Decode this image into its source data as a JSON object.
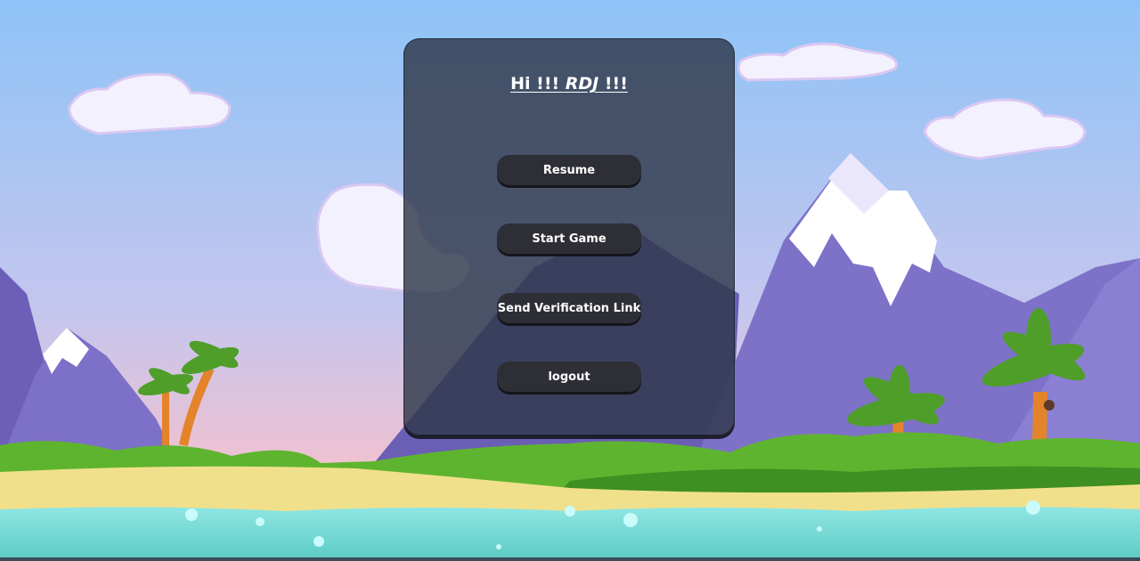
{
  "menu": {
    "greeting_prefix": "Hi !!! ",
    "player_name": "RDJ",
    "greeting_suffix": " !!!",
    "buttons": {
      "resume": "Resume",
      "start_game": "Start Game",
      "send_verification": "Send Verification Link",
      "logout": "logout"
    }
  },
  "colors": {
    "sky_top": "#8ec3f7",
    "sky_bottom": "#f2c1cf",
    "mountain": "#7a6ec6",
    "snow": "#ffffff",
    "grass": "#5fb42f",
    "sand": "#f0e08c",
    "water": "#6fd6d0",
    "panel": "#30384a",
    "button": "#2e2f36"
  }
}
